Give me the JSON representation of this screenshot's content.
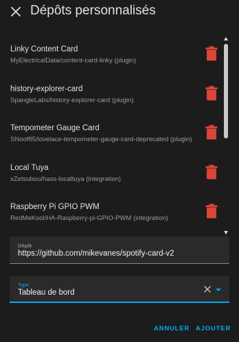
{
  "dialog": {
    "title": "Dépôts personnalisés",
    "close_icon": "close-icon"
  },
  "repositories": [
    {
      "name": "Linky Content Card",
      "description": "MyElectricalData/content-card-linky (plugin)",
      "delete_icon": "trash-icon"
    },
    {
      "name": "history-explorer-card",
      "description": "SpangleLabs/history-explorer-card (plugin)",
      "delete_icon": "trash-icon"
    },
    {
      "name": "Tempometer Gauge Card",
      "description": "SNoof85/lovelace-tempometer-gauge-card-deprecated (plugin)",
      "delete_icon": "trash-icon"
    },
    {
      "name": "Local Tuya",
      "description": "xZetsubou/hass-localtuya (integration)",
      "delete_icon": "trash-icon"
    },
    {
      "name": "Raspberry Pi GPIO PWM",
      "description": "RedMeKool/HA-Raspberry-pi-GPIO-PWM (integration)",
      "delete_icon": "trash-icon"
    }
  ],
  "form": {
    "repo_field": {
      "label": "Dépôt",
      "value": "https://github.com/mikevanes/spotify-card-v2"
    },
    "type_field": {
      "label": "Type",
      "value": "Tableau de bord"
    }
  },
  "actions": {
    "cancel_label": "ANNULER",
    "add_label": "AJOUTER"
  },
  "colors": {
    "background": "#1c1c1c",
    "accent": "#03a9f4",
    "delete": "#db4437"
  }
}
